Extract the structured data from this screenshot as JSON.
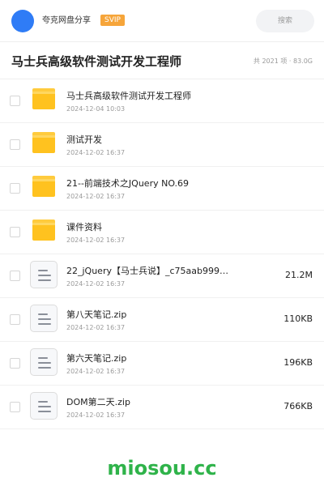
{
  "header": {
    "share_name": "夸克网盘分享",
    "badge": "SVIP",
    "search_placeholder": "搜索"
  },
  "title_bar": {
    "title": "马士兵高级软件测试开发工程师",
    "stats": "共 2021 项 · 83.0G"
  },
  "items": [
    {
      "type": "folder",
      "name": "马士兵高级软件测试开发工程师",
      "date": "2024-12-04 10:03",
      "size": ""
    },
    {
      "type": "folder",
      "name": "测试开发",
      "date": "2024-12-02 16:37",
      "size": ""
    },
    {
      "type": "folder",
      "name": "21--前端技术之JQuery NO.69",
      "date": "2024-12-02 16:37",
      "size": ""
    },
    {
      "type": "folder",
      "name": "课件资料",
      "date": "2024-12-02 16:37",
      "size": ""
    },
    {
      "type": "file",
      "name": "22_jQuery【马士兵说】_c75aab999…",
      "date": "2024-12-02 16:37",
      "size": "21.2M"
    },
    {
      "type": "file",
      "name": "第八天笔记.zip",
      "date": "2024-12-02 16:37",
      "size": "110KB"
    },
    {
      "type": "file",
      "name": "第六天笔记.zip",
      "date": "2024-12-02 16:37",
      "size": "196KB"
    },
    {
      "type": "file",
      "name": "DOM第二天.zip",
      "date": "2024-12-02 16:37",
      "size": "766KB"
    }
  ],
  "watermark": "miosou.cc",
  "colors": {
    "avatar": "#2f7cf6",
    "badge": "#f6a53a",
    "folder": "#ffc21f",
    "watermark": "#2fb34a"
  }
}
